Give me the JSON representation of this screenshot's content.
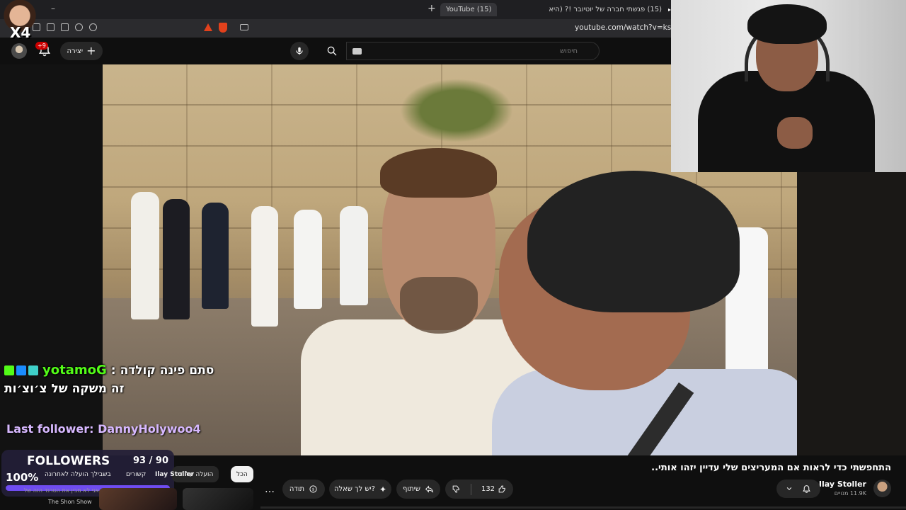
{
  "browser": {
    "tabs": [
      {
        "title": "(15) פגשתי חברה של יוטיובר !? (היא",
        "active": false
      },
      {
        "title": "(15) YouTube",
        "active": true
      }
    ],
    "url": "youtube.com/watch?v=ksXF2vFC"
  },
  "header": {
    "create_label": "יצירה",
    "notification_count": "+9",
    "search_placeholder": "חיפוש"
  },
  "stream_overlay": {
    "multiplier": "X4",
    "chat": {
      "username": "yotamoG",
      "separator": ":",
      "message1": "סתם פינה קולדה",
      "message2": "זה משקה של צ׳וצ׳ות",
      "badge_colors": [
        "#53fc18",
        "#1a8cff",
        "#3fd0c9"
      ]
    },
    "last_follower": "Last follower: DannyHolywoo4",
    "followers_goal": {
      "title": "FOLLOWERS",
      "count": "93 / 90",
      "percent_label": "100%",
      "progress": 1.0,
      "fill_color": "#6f4cf0"
    }
  },
  "video": {
    "title": "התחפשתי כדי לראות אם המעריצים שלי עדיין יזהו אותי..",
    "channel_name": "Ilay Stoller",
    "subscribers": "11.9K מנויים",
    "likes": "132",
    "share_label": "שיתוף",
    "ask_label": "יש לך שאלה?",
    "thanks_label": "תודה",
    "more_label": "…"
  },
  "recommendations": {
    "chips": [
      "הכל",
      "הועלה על ידי",
      "Ilay Stoller",
      "קשורים",
      "בשבילך",
      "הועלה לאחרונה"
    ],
    "first_title": "אני לא מבין את הטרנד הזה של",
    "first_channel": "The Shon Show"
  },
  "colors": {
    "background": "#0f0f0f",
    "accent_red": "#ff0000",
    "kick_green": "#53fc18"
  }
}
